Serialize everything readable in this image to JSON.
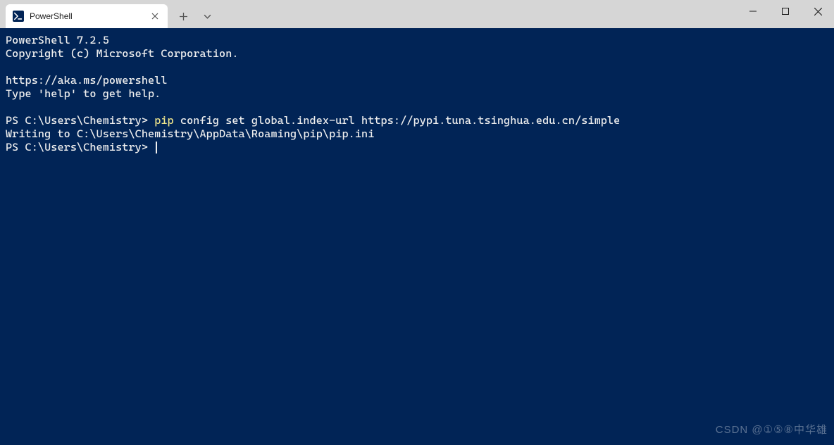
{
  "window": {
    "tab_title": "PowerShell"
  },
  "terminal": {
    "line1": "PowerShell 7.2.5",
    "line2": "Copyright (c) Microsoft Corporation.",
    "line3": "",
    "line4": "https://aka.ms/powershell",
    "line5": "Type 'help' to get help.",
    "line6": "",
    "prompt1_prefix": "PS C:\\Users\\Chemistry> ",
    "cmd_highlight": "pip",
    "cmd_rest": " config set global.index-url https://pypi.tuna.tsinghua.edu.cn/simple",
    "line8": "Writing to C:\\Users\\Chemistry\\AppData\\Roaming\\pip\\pip.ini",
    "prompt2": "PS C:\\Users\\Chemistry> "
  },
  "watermark": "CSDN @①⑤⑧中华雄"
}
